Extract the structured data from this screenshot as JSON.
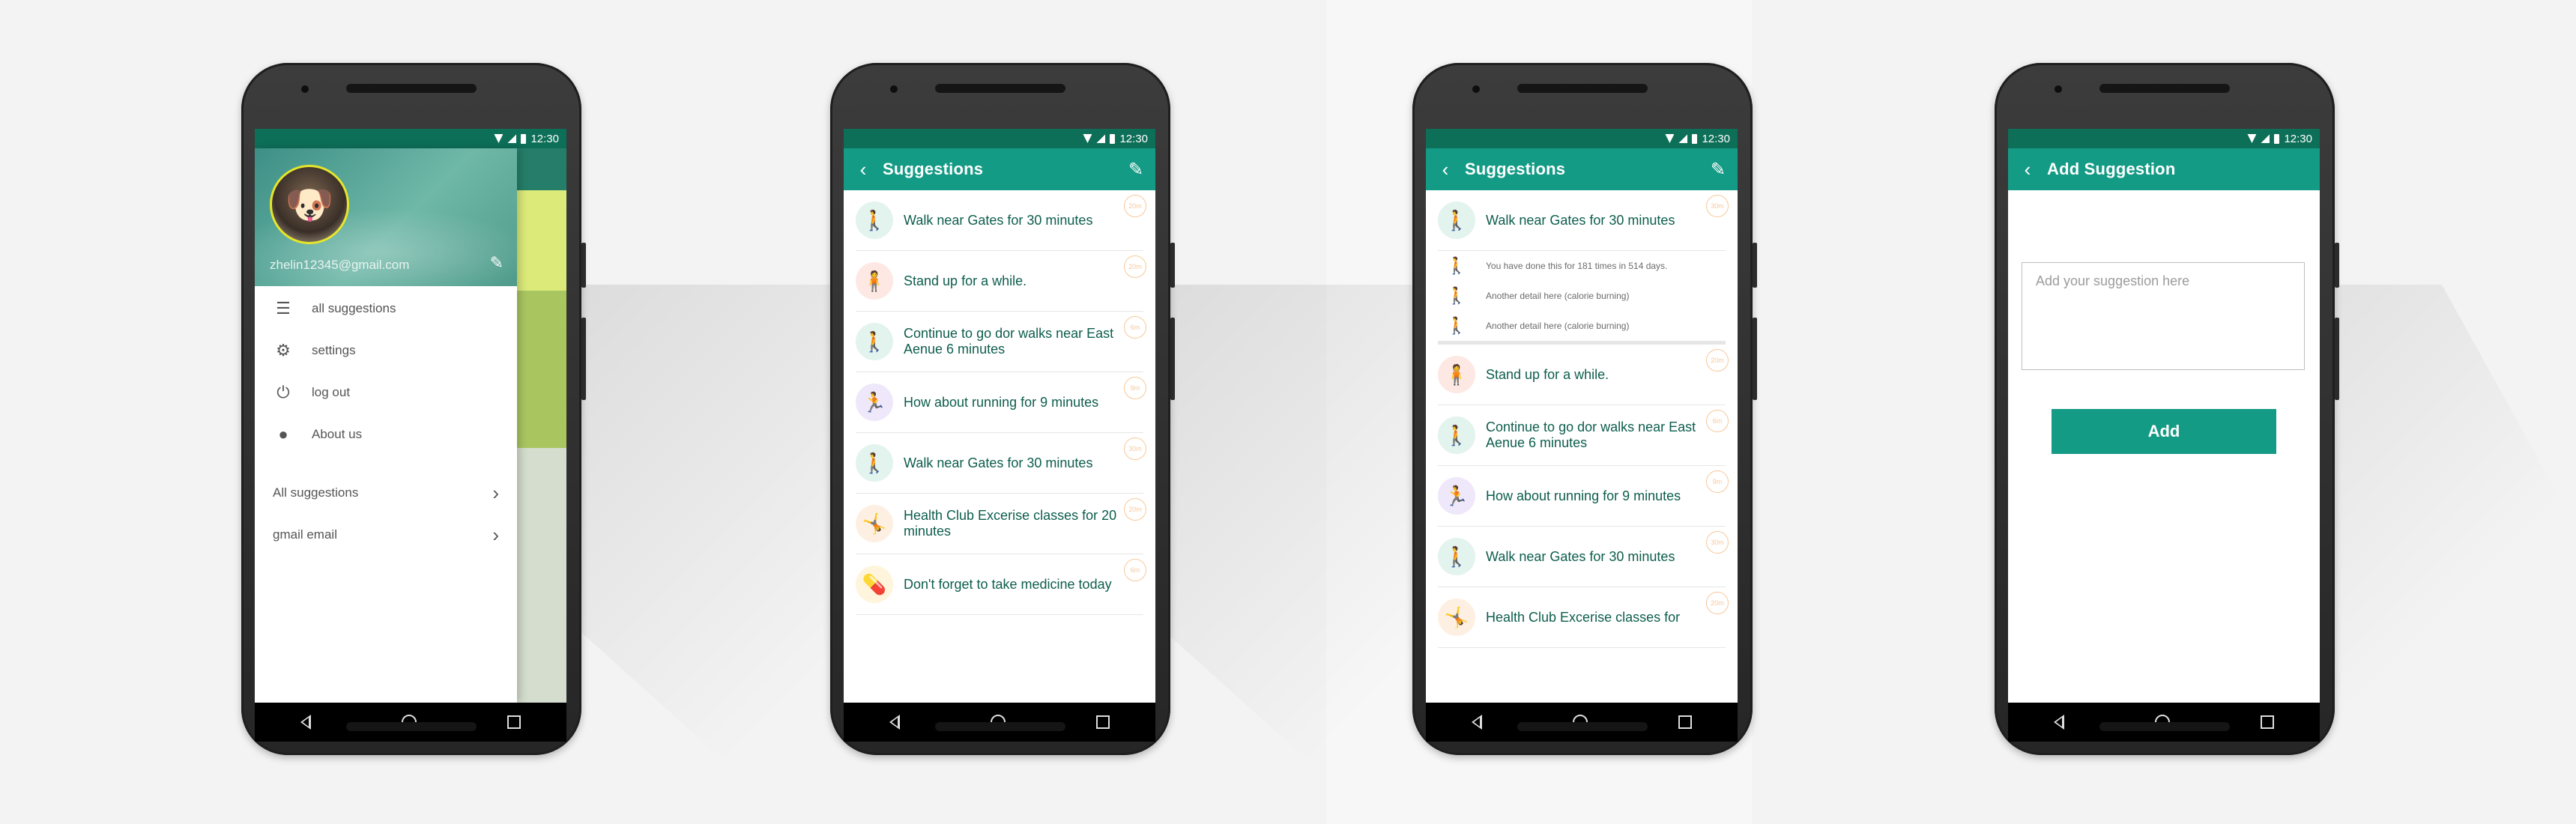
{
  "status_time": "12:30",
  "nav_icons": [
    "back-nav-icon",
    "home-nav-icon",
    "recents-nav-icon"
  ],
  "colors": {
    "primary": "#149b85",
    "status": "#0d6f58",
    "tag": "#f7c89a"
  },
  "phone1": {
    "email": "zhelin12345@gmail.com",
    "menu": [
      {
        "label": "all suggestions",
        "icon": "list-icon"
      },
      {
        "label": "settings",
        "icon": "gear-icon"
      },
      {
        "label": "log out",
        "icon": "power-icon"
      },
      {
        "label": "About us",
        "icon": "info-icon"
      }
    ],
    "menu2": [
      {
        "label": "All suggestions"
      },
      {
        "label": "gmail email"
      }
    ]
  },
  "phone2": {
    "title": "Suggestions",
    "items": [
      {
        "text": "Walk near Gates for 30 minutes",
        "tag": "20m"
      },
      {
        "text": "Stand up for a while.",
        "tag": "20m"
      },
      {
        "text": "Continue to go dor walks near East Aenue 6 minutes",
        "tag": "6m"
      },
      {
        "text": "How about running for 9 minutes",
        "tag": "9m"
      },
      {
        "text": "Walk near Gates for 30 minutes",
        "tag": "30m"
      },
      {
        "text": "Health Club Excerise classes for 20 minutes",
        "tag": "20m"
      },
      {
        "text": "Don't forget to take medicine today",
        "tag": "6m"
      }
    ]
  },
  "phone3": {
    "title": "Suggestions",
    "first": {
      "text": "Walk near Gates for 30 minutes",
      "tag": "30m"
    },
    "details": [
      "You have done this for 181 times in 514 days.",
      "Another detail here (calorie burning)",
      "Another detail here (calorie burning)"
    ],
    "items": [
      {
        "text": "Stand up for a while.",
        "tag": "20m"
      },
      {
        "text": "Continue to go dor walks near East Aenue 6 minutes",
        "tag": "6m"
      },
      {
        "text": "How about running for 9 minutes",
        "tag": "9m"
      },
      {
        "text": "Walk near Gates for 30 minutes",
        "tag": "30m"
      },
      {
        "text": "Health Club Excerise classes for",
        "tag": "20m"
      }
    ]
  },
  "phone4": {
    "title": "Add Suggestion",
    "placeholder": "Add your suggestion here",
    "button": "Add"
  }
}
